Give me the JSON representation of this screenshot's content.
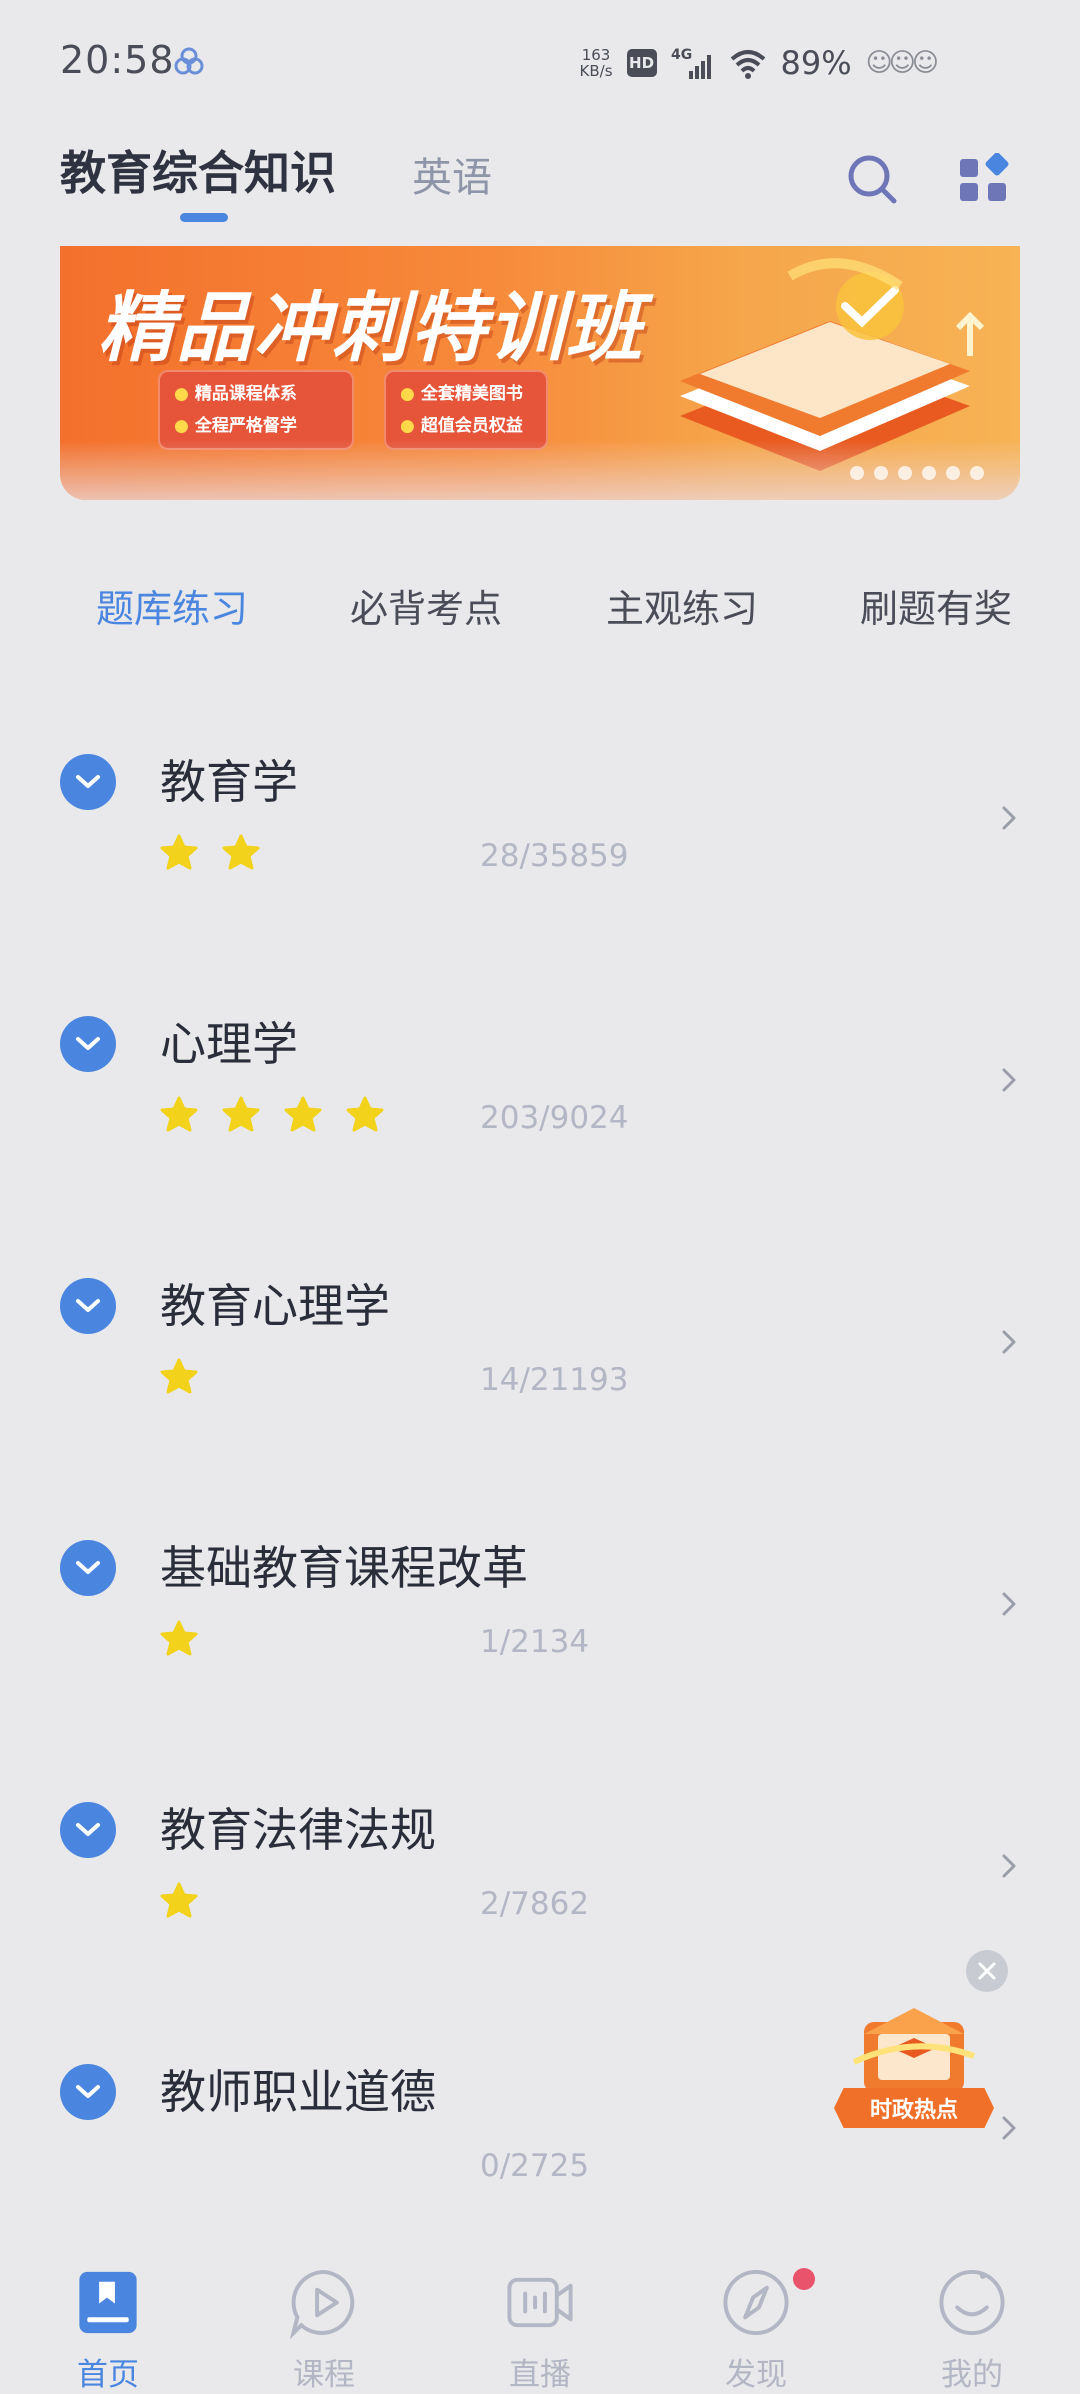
{
  "status_bar": {
    "time": "20:58",
    "net_speed_value": "163",
    "net_speed_unit": "KB/s",
    "hd": "HD",
    "network": "4G",
    "battery": "89%"
  },
  "header": {
    "tab_main": "教育综合知识",
    "tab_second": "英语"
  },
  "banner": {
    "title": "精品冲刺特训班",
    "box_left": [
      "精品课程体系",
      "全程严格督学"
    ],
    "box_right": [
      "全套精美图书",
      "超值会员权益"
    ],
    "slide_count": 6
  },
  "categories": {
    "items": [
      "题库练习",
      "必背考点",
      "主观练习",
      "刷题有奖"
    ],
    "active_index": 0
  },
  "subjects": [
    {
      "title": "教育学",
      "stars": 2,
      "progress": "28/35859"
    },
    {
      "title": "心理学",
      "stars": 4,
      "progress": "203/9024"
    },
    {
      "title": "教育心理学",
      "stars": 1,
      "progress": "14/21193"
    },
    {
      "title": "基础教育课程改革",
      "stars": 1,
      "progress": "1/2134"
    },
    {
      "title": "教育法律法规",
      "stars": 1,
      "progress": "2/7862"
    },
    {
      "title": "教师职业道德",
      "stars": 0,
      "progress": "0/2725"
    }
  ],
  "floating_promo": {
    "label": "时政热点"
  },
  "bottom_nav": {
    "items": [
      {
        "label": "首页",
        "icon": "home-book-icon"
      },
      {
        "label": "课程",
        "icon": "course-play-icon"
      },
      {
        "label": "直播",
        "icon": "live-video-icon"
      },
      {
        "label": "发现",
        "icon": "discover-compass-icon"
      },
      {
        "label": "我的",
        "icon": "profile-icon"
      }
    ],
    "active_index": 0
  },
  "colors": {
    "accent": "#4a86e0",
    "star": "#f2d21a",
    "muted_text": "#b3b6c4",
    "badge_red": "#e9536b"
  }
}
